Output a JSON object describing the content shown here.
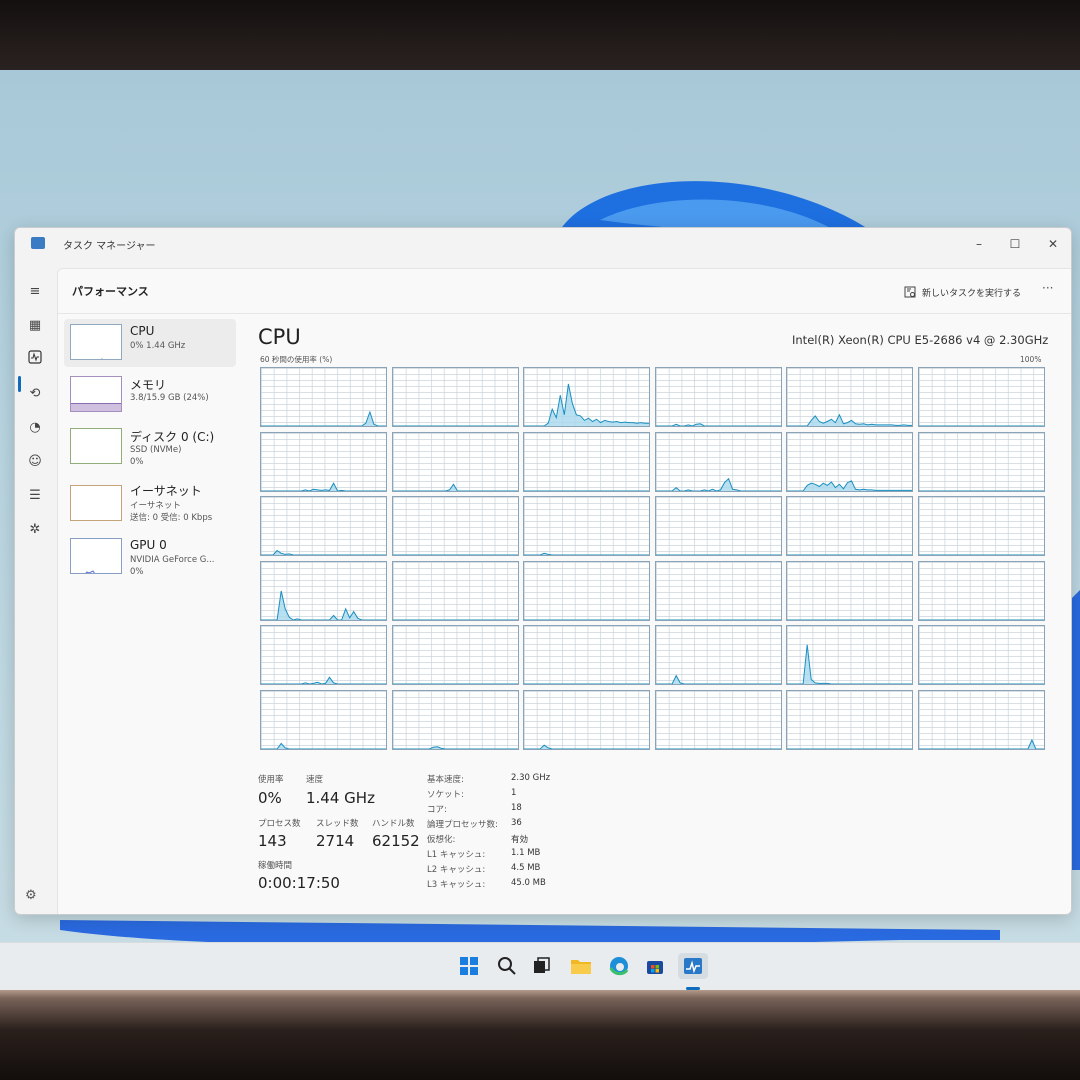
{
  "window": {
    "title": "タスク マネージャー",
    "minimize_symbol": "–",
    "maximize_symbol": "☐",
    "close_symbol": "✕"
  },
  "toolbar": {
    "page_title": "パフォーマンス",
    "run_new_task_label": "新しいタスクを実行する",
    "more_symbol": "···"
  },
  "nav_icons": [
    "hamburger-menu-icon",
    "processes-icon",
    "performance-icon",
    "app-history-icon",
    "startup-apps-icon",
    "users-icon",
    "details-icon",
    "services-icon",
    "settings-icon"
  ],
  "perf_list": [
    {
      "name": "CPU",
      "lines": [
        "0%  1.44 GHz"
      ],
      "selected": true
    },
    {
      "name": "メモリ",
      "lines": [
        "3.8/15.9 GB (24%)"
      ],
      "selected": false
    },
    {
      "name": "ディスク 0 (C:)",
      "lines": [
        "SSD (NVMe)",
        "0%"
      ],
      "selected": false
    },
    {
      "name": "イーサネット",
      "lines": [
        "イーサネット",
        "送信: 0 受信: 0 Kbps"
      ],
      "selected": false
    },
    {
      "name": "GPU 0",
      "lines": [
        "NVIDIA GeForce G...",
        "0%"
      ],
      "selected": false
    }
  ],
  "cpu": {
    "title": "CPU",
    "model": "Intel(R) Xeon(R) CPU E5-2686 v4 @ 2.30GHz",
    "graph_caption": "60 秒間の使用率 (%)",
    "graph_max": "100%"
  },
  "stats": {
    "utilization_label": "使用率",
    "utilization_value": "0%",
    "speed_label": "速度",
    "speed_value": "1.44 GHz",
    "processes_label": "プロセス数",
    "processes_value": "143",
    "threads_label": "スレッド数",
    "threads_value": "2714",
    "handles_label": "ハンドル数",
    "handles_value": "62152",
    "uptime_label": "稼働時間",
    "uptime_value": "0:00:17:50"
  },
  "specs": [
    {
      "label": "基本速度:",
      "value": "2.30 GHz"
    },
    {
      "label": "ソケット:",
      "value": "1"
    },
    {
      "label": "コア:",
      "value": "18"
    },
    {
      "label": "論理プロセッサ数:",
      "value": "36"
    },
    {
      "label": "仮想化:",
      "value": "有効"
    },
    {
      "label": "L1 キャッシュ:",
      "value": "1.1 MB"
    },
    {
      "label": "L2 キャッシュ:",
      "value": "4.5 MB"
    },
    {
      "label": "L3 キャッシュ:",
      "value": "45.0 MB"
    }
  ],
  "taskbar_icons": [
    "windows-start-icon",
    "search-icon",
    "task-view-icon",
    "file-explorer-icon",
    "edge-browser-icon",
    "microsoft-store-icon",
    "task-manager-icon"
  ],
  "colors": {
    "accent": "#0f6cbd",
    "graph_line": "#1a8fc0",
    "graph_fill": "#a6d8ec",
    "graph_border": "#8aa3b6"
  },
  "chart_data": {
    "type": "area",
    "ylim": [
      0,
      100
    ],
    "x": [
      0,
      4,
      8,
      12,
      16,
      20,
      24,
      28,
      32,
      36,
      40,
      44,
      48,
      52,
      56,
      60,
      64,
      68,
      72,
      76,
      80,
      84,
      88,
      92,
      96,
      100,
      104,
      108,
      112,
      116,
      120,
      124
    ],
    "series": [
      {
        "values": [
          0,
          0,
          0,
          0,
          0,
          0,
          0,
          0,
          0,
          0,
          0,
          0,
          0,
          0,
          0,
          0,
          0,
          0,
          0,
          0,
          0,
          0,
          0,
          0,
          0,
          0,
          5,
          25,
          3,
          0,
          0,
          0
        ]
      },
      {
        "values": [
          0,
          0,
          0,
          0,
          0,
          0,
          0,
          0,
          0,
          0,
          0,
          0,
          0,
          0,
          0,
          0,
          0,
          0,
          0,
          0,
          0,
          0,
          0,
          0,
          0,
          0,
          0,
          0,
          0,
          0,
          0,
          0
        ]
      },
      {
        "values": [
          0,
          0,
          0,
          0,
          0,
          0,
          5,
          30,
          15,
          55,
          20,
          75,
          40,
          20,
          18,
          10,
          14,
          8,
          12,
          6,
          10,
          8,
          7,
          8,
          6,
          7,
          6,
          6,
          5,
          6,
          5,
          5
        ]
      },
      {
        "values": [
          0,
          0,
          0,
          0,
          0,
          3,
          0,
          0,
          2,
          0,
          3,
          4,
          0,
          0,
          0,
          0,
          0,
          0,
          0,
          0,
          0,
          0,
          0,
          0,
          0,
          0,
          0,
          0,
          0,
          0,
          0,
          0
        ]
      },
      {
        "values": [
          0,
          0,
          0,
          0,
          0,
          0,
          10,
          18,
          8,
          5,
          8,
          12,
          6,
          20,
          4,
          6,
          10,
          4,
          3,
          4,
          2,
          3,
          2,
          2,
          2,
          2,
          2,
          1,
          1,
          2,
          1,
          1
        ]
      },
      {
        "values": [
          0,
          0,
          0,
          0,
          0,
          0,
          0,
          0,
          0,
          0,
          0,
          0,
          0,
          0,
          0,
          0,
          0,
          0,
          0,
          0,
          0,
          0,
          0,
          0,
          0,
          0,
          0,
          0,
          0,
          0,
          0,
          0
        ]
      },
      {
        "values": [
          0,
          0,
          0,
          0,
          0,
          0,
          0,
          0,
          0,
          0,
          0,
          2,
          0,
          3,
          2,
          1,
          2,
          1,
          14,
          0,
          1,
          0,
          0,
          0,
          0,
          0,
          0,
          0,
          0,
          0,
          0,
          0
        ]
      },
      {
        "values": [
          0,
          0,
          0,
          0,
          0,
          0,
          0,
          0,
          0,
          0,
          0,
          0,
          0,
          0,
          2,
          12,
          0,
          0,
          0,
          0,
          0,
          0,
          0,
          0,
          0,
          0,
          0,
          0,
          0,
          0,
          0,
          0
        ]
      },
      {
        "values": [
          0,
          0,
          0,
          0,
          0,
          0,
          0,
          0,
          0,
          0,
          0,
          0,
          0,
          0,
          0,
          0,
          0,
          0,
          0,
          0,
          0,
          0,
          0,
          0,
          0,
          0,
          0,
          0,
          0,
          0,
          0,
          0
        ]
      },
      {
        "values": [
          0,
          0,
          0,
          0,
          0,
          6,
          0,
          0,
          2,
          0,
          0,
          0,
          2,
          0,
          3,
          0,
          2,
          15,
          22,
          3,
          2,
          0,
          0,
          0,
          0,
          0,
          0,
          0,
          0,
          0,
          0,
          0
        ]
      },
      {
        "values": [
          0,
          0,
          0,
          0,
          0,
          10,
          14,
          12,
          8,
          14,
          10,
          16,
          6,
          12,
          4,
          15,
          18,
          3,
          2,
          3,
          2,
          2,
          1,
          1,
          1,
          1,
          1,
          1,
          1,
          1,
          1,
          1
        ]
      },
      {
        "values": [
          0,
          0,
          0,
          0,
          0,
          0,
          0,
          0,
          0,
          0,
          0,
          0,
          0,
          0,
          0,
          0,
          0,
          0,
          0,
          0,
          0,
          0,
          0,
          0,
          0,
          0,
          0,
          0,
          0,
          0,
          0,
          0
        ]
      },
      {
        "values": [
          0,
          0,
          0,
          0,
          8,
          3,
          1,
          2,
          0,
          0,
          0,
          0,
          0,
          0,
          0,
          0,
          0,
          0,
          0,
          0,
          0,
          0,
          0,
          0,
          0,
          0,
          0,
          0,
          0,
          0,
          0,
          0
        ]
      },
      {
        "values": [
          0,
          0,
          0,
          0,
          0,
          0,
          0,
          0,
          0,
          0,
          0,
          0,
          0,
          0,
          0,
          0,
          0,
          0,
          0,
          0,
          0,
          0,
          0,
          0,
          0,
          0,
          0,
          0,
          0,
          0,
          0,
          0
        ]
      },
      {
        "values": [
          0,
          0,
          0,
          0,
          0,
          3,
          1,
          0,
          0,
          0,
          0,
          0,
          0,
          0,
          0,
          0,
          0,
          0,
          0,
          0,
          0,
          0,
          0,
          0,
          0,
          0,
          0,
          0,
          0,
          0,
          0,
          0
        ]
      },
      {
        "values": [
          0,
          0,
          0,
          0,
          0,
          0,
          0,
          0,
          0,
          0,
          0,
          0,
          0,
          0,
          0,
          0,
          0,
          0,
          0,
          0,
          0,
          0,
          0,
          0,
          0,
          0,
          0,
          0,
          0,
          0,
          0,
          0
        ]
      },
      {
        "values": [
          0,
          0,
          0,
          0,
          0,
          0,
          0,
          0,
          0,
          0,
          0,
          0,
          0,
          0,
          0,
          0,
          0,
          0,
          0,
          0,
          0,
          0,
          0,
          0,
          0,
          0,
          0,
          0,
          0,
          0,
          0,
          0
        ]
      },
      {
        "values": [
          0,
          0,
          0,
          0,
          0,
          0,
          0,
          0,
          0,
          0,
          0,
          0,
          0,
          0,
          0,
          0,
          0,
          0,
          0,
          0,
          0,
          0,
          0,
          0,
          0,
          0,
          0,
          0,
          0,
          0,
          0,
          0
        ]
      },
      {
        "values": [
          0,
          0,
          0,
          0,
          0,
          52,
          20,
          5,
          0,
          2,
          0,
          0,
          0,
          0,
          0,
          0,
          0,
          0,
          8,
          0,
          0,
          20,
          4,
          15,
          3,
          0,
          0,
          0,
          0,
          0,
          0,
          0
        ]
      },
      {
        "values": [
          0,
          0,
          0,
          0,
          0,
          0,
          0,
          0,
          0,
          0,
          0,
          0,
          0,
          0,
          0,
          0,
          0,
          0,
          0,
          0,
          0,
          0,
          0,
          0,
          0,
          0,
          0,
          0,
          0,
          0,
          0,
          0
        ]
      },
      {
        "values": [
          0,
          0,
          0,
          0,
          0,
          0,
          0,
          0,
          0,
          0,
          0,
          0,
          0,
          0,
          0,
          0,
          0,
          0,
          0,
          0,
          0,
          0,
          0,
          0,
          0,
          0,
          0,
          0,
          0,
          0,
          0,
          0
        ]
      },
      {
        "values": [
          0,
          0,
          0,
          0,
          0,
          0,
          0,
          0,
          0,
          0,
          0,
          0,
          0,
          0,
          0,
          0,
          0,
          0,
          0,
          0,
          0,
          0,
          0,
          0,
          0,
          0,
          0,
          0,
          0,
          0,
          0,
          0
        ]
      },
      {
        "values": [
          0,
          0,
          0,
          0,
          0,
          0,
          0,
          0,
          0,
          0,
          0,
          0,
          0,
          0,
          0,
          0,
          0,
          0,
          0,
          0,
          0,
          0,
          0,
          0,
          0,
          0,
          0,
          0,
          0,
          0,
          0,
          0
        ]
      },
      {
        "values": [
          0,
          0,
          0,
          0,
          0,
          0,
          0,
          0,
          0,
          0,
          0,
          0,
          0,
          0,
          0,
          0,
          0,
          0,
          0,
          0,
          0,
          0,
          0,
          0,
          0,
          0,
          0,
          0,
          0,
          0,
          0,
          0
        ]
      },
      {
        "values": [
          0,
          0,
          0,
          0,
          0,
          0,
          0,
          0,
          0,
          0,
          0,
          2,
          0,
          1,
          3,
          0,
          1,
          12,
          2,
          0,
          0,
          0,
          0,
          0,
          0,
          0,
          0,
          0,
          0,
          0,
          0,
          0
        ]
      },
      {
        "values": [
          0,
          0,
          0,
          0,
          0,
          0,
          0,
          0,
          0,
          0,
          0,
          0,
          0,
          0,
          0,
          0,
          0,
          0,
          0,
          0,
          0,
          0,
          0,
          0,
          0,
          0,
          0,
          0,
          0,
          0,
          0,
          0
        ]
      },
      {
        "values": [
          0,
          0,
          0,
          0,
          0,
          0,
          0,
          0,
          0,
          0,
          0,
          0,
          0,
          0,
          0,
          0,
          0,
          0,
          0,
          0,
          0,
          0,
          0,
          0,
          0,
          0,
          0,
          0,
          0,
          0,
          0,
          0
        ]
      },
      {
        "values": [
          0,
          0,
          0,
          0,
          0,
          15,
          2,
          0,
          0,
          0,
          0,
          0,
          0,
          0,
          0,
          0,
          0,
          0,
          0,
          0,
          0,
          0,
          0,
          0,
          0,
          0,
          0,
          0,
          0,
          0,
          0,
          0
        ]
      },
      {
        "values": [
          0,
          0,
          0,
          0,
          0,
          70,
          8,
          2,
          1,
          1,
          1,
          0,
          0,
          0,
          0,
          0,
          0,
          0,
          0,
          0,
          0,
          0,
          0,
          0,
          0,
          0,
          0,
          0,
          0,
          0,
          0,
          0
        ]
      },
      {
        "values": [
          0,
          0,
          0,
          0,
          0,
          0,
          0,
          0,
          0,
          0,
          0,
          0,
          0,
          0,
          0,
          0,
          0,
          0,
          0,
          0,
          0,
          0,
          0,
          0,
          0,
          0,
          0,
          0,
          0,
          0,
          0,
          0
        ]
      },
      {
        "values": [
          0,
          0,
          0,
          0,
          0,
          10,
          2,
          0,
          0,
          0,
          0,
          0,
          0,
          0,
          0,
          0,
          0,
          0,
          0,
          0,
          0,
          0,
          0,
          0,
          0,
          0,
          0,
          0,
          0,
          0,
          0,
          0
        ]
      },
      {
        "values": [
          0,
          0,
          0,
          0,
          0,
          0,
          0,
          0,
          0,
          0,
          3,
          4,
          1,
          0,
          0,
          0,
          0,
          0,
          0,
          0,
          0,
          0,
          0,
          0,
          0,
          0,
          0,
          0,
          0,
          0,
          0,
          0
        ]
      },
      {
        "values": [
          0,
          0,
          0,
          0,
          0,
          7,
          2,
          0,
          0,
          0,
          0,
          0,
          0,
          0,
          0,
          0,
          0,
          0,
          0,
          0,
          0,
          0,
          0,
          0,
          0,
          0,
          0,
          0,
          0,
          0,
          0,
          0
        ]
      },
      {
        "values": [
          0,
          0,
          0,
          0,
          0,
          0,
          0,
          0,
          0,
          0,
          0,
          0,
          0,
          0,
          0,
          0,
          0,
          0,
          0,
          0,
          0,
          0,
          0,
          0,
          0,
          0,
          0,
          0,
          0,
          0,
          0,
          0
        ]
      },
      {
        "values": [
          0,
          0,
          0,
          0,
          0,
          0,
          0,
          0,
          0,
          0,
          0,
          0,
          0,
          0,
          0,
          0,
          0,
          0,
          0,
          0,
          0,
          0,
          0,
          0,
          0,
          0,
          0,
          0,
          0,
          0,
          0,
          0
        ]
      },
      {
        "values": [
          0,
          0,
          0,
          0,
          0,
          0,
          0,
          0,
          0,
          0,
          0,
          0,
          0,
          0,
          0,
          0,
          0,
          0,
          0,
          0,
          0,
          0,
          0,
          0,
          0,
          0,
          0,
          0,
          16,
          0,
          0,
          0
        ]
      }
    ]
  }
}
